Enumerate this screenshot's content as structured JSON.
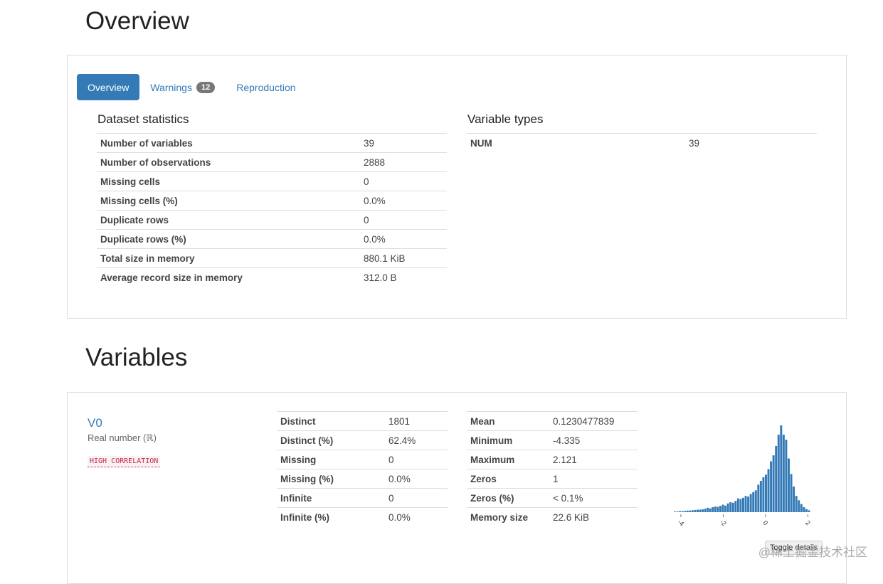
{
  "overview_heading": "Overview",
  "variables_heading": "Variables",
  "tabs": [
    {
      "label": "Overview",
      "active": true
    },
    {
      "label": "Warnings",
      "badge": "12"
    },
    {
      "label": "Reproduction"
    }
  ],
  "dataset_statistics": {
    "title": "Dataset statistics",
    "rows": [
      {
        "label": "Number of variables",
        "value": "39"
      },
      {
        "label": "Number of observations",
        "value": "2888"
      },
      {
        "label": "Missing cells",
        "value": "0"
      },
      {
        "label": "Missing cells (%)",
        "value": "0.0%"
      },
      {
        "label": "Duplicate rows",
        "value": "0"
      },
      {
        "label": "Duplicate rows (%)",
        "value": "0.0%"
      },
      {
        "label": "Total size in memory",
        "value": "880.1 KiB"
      },
      {
        "label": "Average record size in memory",
        "value": "312.0 B"
      }
    ]
  },
  "variable_types": {
    "title": "Variable types",
    "rows": [
      {
        "label": "NUM",
        "value": "39"
      }
    ]
  },
  "variable": {
    "name": "V0",
    "type": "Real number (ℝ)",
    "warning_badge": "HIGH CORRELATION",
    "stats_left": [
      {
        "label": "Distinct",
        "value": "1801"
      },
      {
        "label": "Distinct (%)",
        "value": "62.4%"
      },
      {
        "label": "Missing",
        "value": "0"
      },
      {
        "label": "Missing (%)",
        "value": "0.0%"
      },
      {
        "label": "Infinite",
        "value": "0"
      },
      {
        "label": "Infinite (%)",
        "value": "0.0%"
      }
    ],
    "stats_right": [
      {
        "label": "Mean",
        "value": "0.1230477839"
      },
      {
        "label": "Minimum",
        "value": "-4.335"
      },
      {
        "label": "Maximum",
        "value": "2.121"
      },
      {
        "label": "Zeros",
        "value": "1"
      },
      {
        "label": "Zeros (%)",
        "value": "< 0.1%"
      },
      {
        "label": "Memory size",
        "value": "22.6 KiB"
      }
    ],
    "toggle_label": "Toggle details"
  },
  "histogram": {
    "color": "#337ab7",
    "x_ticks": [
      "-4",
      "-2",
      "0",
      "2"
    ],
    "x_tick_values": [
      -4,
      -2,
      0,
      2
    ],
    "x_range": [
      -4.335,
      2.121
    ],
    "counts": [
      2,
      2,
      3,
      3,
      4,
      5,
      5,
      6,
      7,
      8,
      8,
      9,
      11,
      14,
      12,
      16,
      18,
      17,
      20,
      24,
      21,
      28,
      32,
      30,
      36,
      44,
      42,
      46,
      52,
      50,
      58,
      64,
      70,
      88,
      100,
      112,
      120,
      138,
      163,
      182,
      212,
      248,
      278,
      248,
      232,
      172,
      122,
      82,
      52,
      38,
      26,
      16,
      10,
      6
    ]
  },
  "watermark": "@稀土掘金技术社区"
}
